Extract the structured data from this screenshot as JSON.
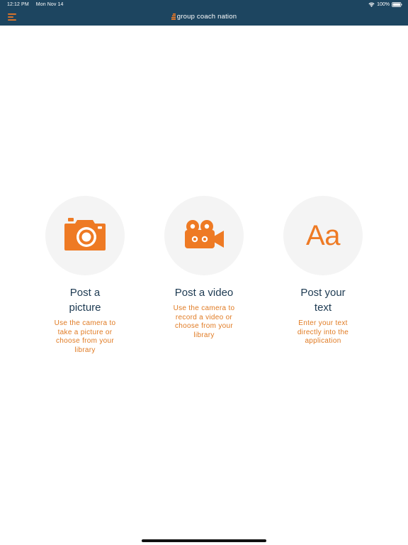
{
  "status_bar": {
    "time": "12:12 PM",
    "date": "Mon Nov 14",
    "battery_percent": "100%",
    "wifi_icon": "wifi-icon",
    "battery_icon": "battery-icon"
  },
  "header": {
    "brand_name": "group coach nation",
    "menu_icon": "hamburger-menu-icon",
    "background_color": "#1d4560",
    "accent_color": "#ee7a24"
  },
  "options": [
    {
      "title": "Post a picture",
      "description": "Use the camera to take a picture or choose from your library",
      "icon": "camera-icon"
    },
    {
      "title": "Post a video",
      "description": "Use the camera to record a video or choose from your library",
      "icon": "video-camera-icon"
    },
    {
      "title": "Post your text",
      "description": "Enter your text directly into the application",
      "icon": "text-icon",
      "icon_glyph": "Aa"
    }
  ]
}
